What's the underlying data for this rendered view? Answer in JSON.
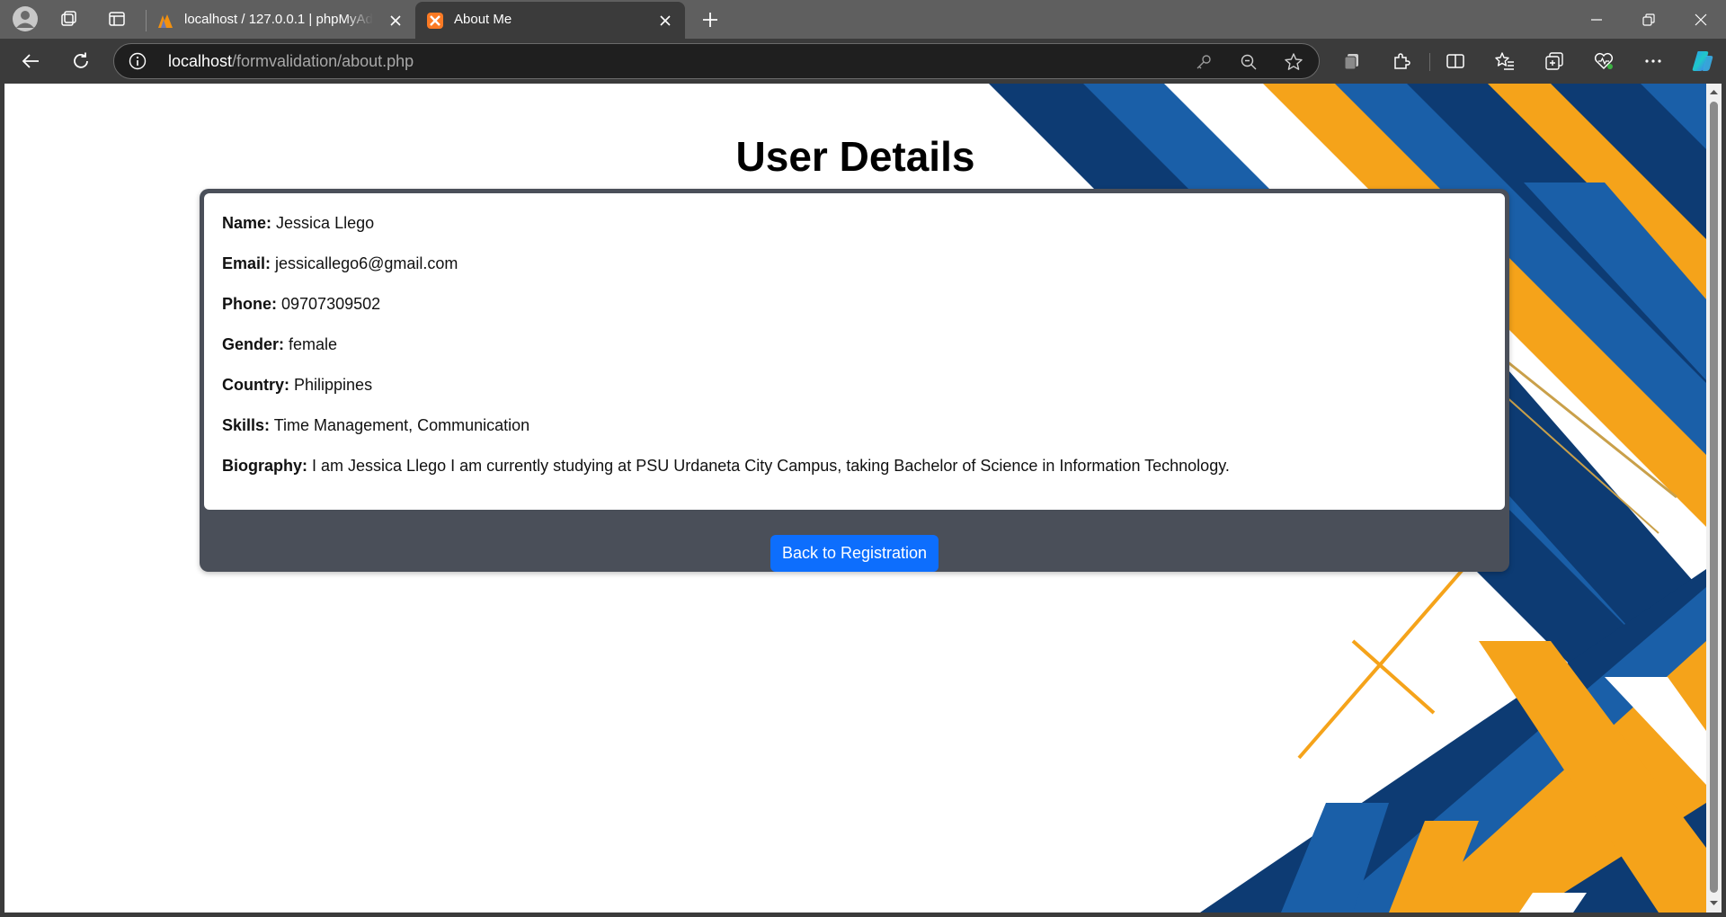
{
  "browser": {
    "tabs": [
      {
        "title": "localhost / 127.0.0.1 | phpMyAdmin",
        "favicon": "phpmyadmin-icon",
        "active": false
      },
      {
        "title": "About Me",
        "favicon": "xampp-icon",
        "active": true
      }
    ],
    "url_host": "localhost",
    "url_path": "/formvalidation/about.php"
  },
  "page": {
    "title": "User Details",
    "fields": [
      {
        "label": "Name:",
        "value": "Jessica Llego"
      },
      {
        "label": "Email:",
        "value": "jessicallego6@gmail.com"
      },
      {
        "label": "Phone:",
        "value": "09707309502"
      },
      {
        "label": "Gender:",
        "value": "female"
      },
      {
        "label": "Country:",
        "value": "Philippines"
      },
      {
        "label": "Skills:",
        "value": "Time Management, Communication"
      },
      {
        "label": "Biography:",
        "value": "I am Jessica Llego I am currently studying at PSU Urdaneta City Campus, taking Bachelor of Science in Information Technology."
      }
    ],
    "back_button": "Back to Registration"
  },
  "colors": {
    "card": "#4a4f59",
    "button": "#0d6efd",
    "art_navy": "#0d3b73",
    "art_blue": "#1a5fa8",
    "art_orange": "#f5a31a"
  }
}
